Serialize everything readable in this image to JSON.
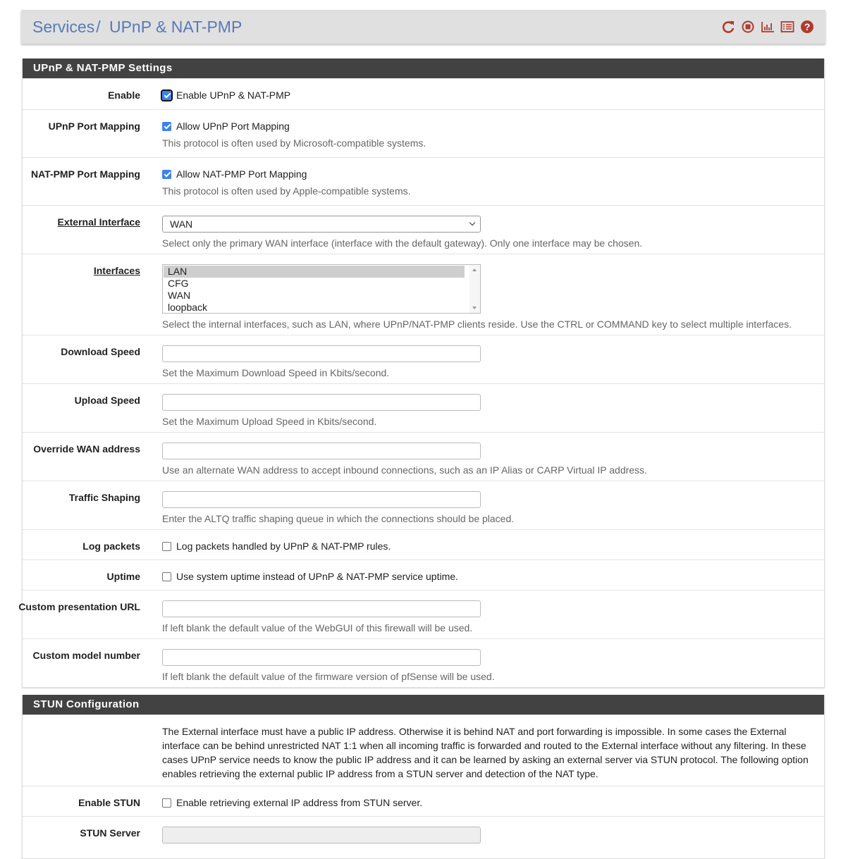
{
  "breadcrumb": {
    "parent": "Services",
    "separator": "/",
    "current": "UPnP & NAT-PMP"
  },
  "header_icons": [
    "reload-icon",
    "stop-icon",
    "chart-icon",
    "list-icon",
    "help-icon"
  ],
  "accent_color": "#b03a2e",
  "settings": {
    "title": "UPnP & NAT-PMP Settings",
    "enable": {
      "label": "Enable",
      "text": "Enable UPnP & NAT-PMP",
      "checked": true
    },
    "upnp": {
      "label": "UPnP Port Mapping",
      "text": "Allow UPnP Port Mapping",
      "checked": true,
      "help": "This protocol is often used by Microsoft-compatible systems."
    },
    "natpmp": {
      "label": "NAT-PMP Port Mapping",
      "text": "Allow NAT-PMP Port Mapping",
      "checked": true,
      "help": "This protocol is often used by Apple-compatible systems."
    },
    "ext_if": {
      "label": "External Interface",
      "value": "WAN",
      "help": "Select only the primary WAN interface (interface with the default gateway). Only one interface may be chosen."
    },
    "interfaces": {
      "label": "Interfaces",
      "options": [
        "LAN",
        "CFG",
        "WAN",
        "loopback"
      ],
      "selected": "LAN",
      "help": "Select the internal interfaces, such as LAN, where UPnP/NAT-PMP clients reside. Use the CTRL or COMMAND key to select multiple interfaces."
    },
    "download": {
      "label": "Download Speed",
      "value": "",
      "help": "Set the Maximum Download Speed in Kbits/second."
    },
    "upload": {
      "label": "Upload Speed",
      "value": "",
      "help": "Set the Maximum Upload Speed in Kbits/second."
    },
    "override": {
      "label": "Override WAN address",
      "value": "",
      "help": "Use an alternate WAN address to accept inbound connections, such as an IP Alias or CARP Virtual IP address."
    },
    "shaping": {
      "label": "Traffic Shaping",
      "value": "",
      "help": "Enter the ALTQ traffic shaping queue in which the connections should be placed."
    },
    "log": {
      "label": "Log packets",
      "text": "Log packets handled by UPnP & NAT-PMP rules.",
      "checked": false
    },
    "uptime": {
      "label": "Uptime",
      "text": "Use system uptime instead of UPnP & NAT-PMP service uptime.",
      "checked": false
    },
    "url": {
      "label": "Custom presentation URL",
      "value": "",
      "help": "If left blank the default value of the WebGUI of this firewall will be used."
    },
    "model": {
      "label": "Custom model number",
      "value": "",
      "help": "If left blank the default value of the firmware version of pfSense will be used."
    }
  },
  "stun": {
    "title": "STUN Configuration",
    "description": "The External interface must have a public IP address. Otherwise it is behind NAT and port forwarding is impossible. In some cases the External interface can be behind unrestricted NAT 1:1 when all incoming traffic is forwarded and routed to the External interface without any filtering. In these cases UPnP service needs to know the public IP address and it can be learned by asking an external server via STUN protocol. The following option enables retrieving the external public IP address from a STUN server and detection of the NAT type.",
    "enable": {
      "label": "Enable STUN",
      "text": "Enable retrieving external IP address from STUN server.",
      "checked": false
    },
    "server": {
      "label": "STUN Server",
      "value": ""
    }
  }
}
